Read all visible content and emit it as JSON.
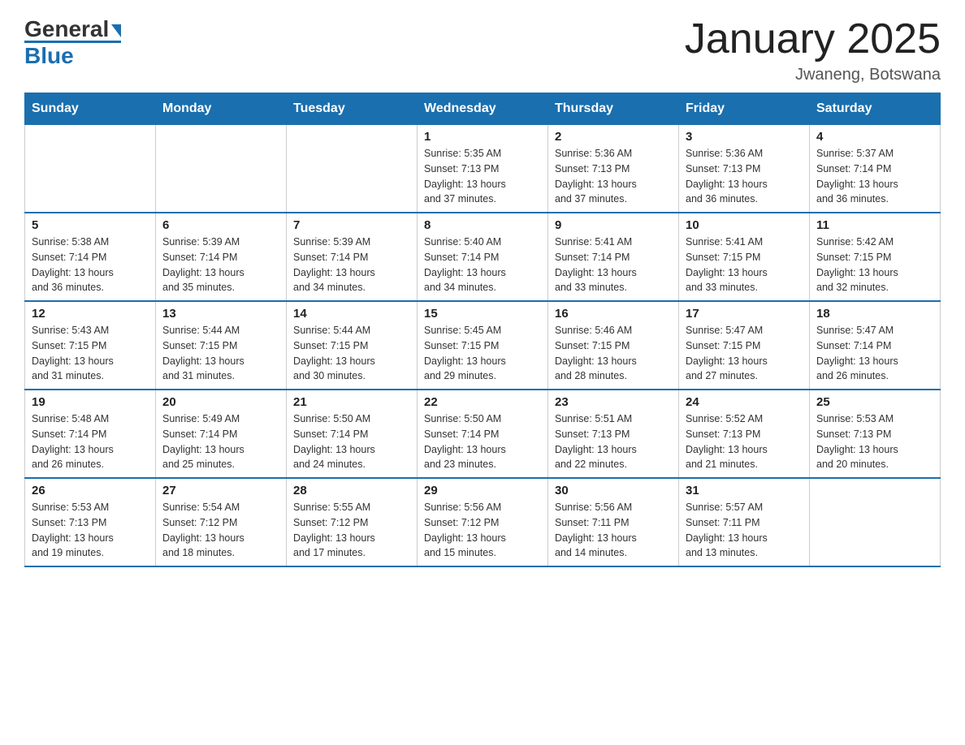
{
  "header": {
    "logo_general": "General",
    "logo_blue": "Blue",
    "title": "January 2025",
    "subtitle": "Jwaneng, Botswana"
  },
  "days_of_week": [
    "Sunday",
    "Monday",
    "Tuesday",
    "Wednesday",
    "Thursday",
    "Friday",
    "Saturday"
  ],
  "weeks": [
    [
      {
        "day": "",
        "info": ""
      },
      {
        "day": "",
        "info": ""
      },
      {
        "day": "",
        "info": ""
      },
      {
        "day": "1",
        "info": "Sunrise: 5:35 AM\nSunset: 7:13 PM\nDaylight: 13 hours\nand 37 minutes."
      },
      {
        "day": "2",
        "info": "Sunrise: 5:36 AM\nSunset: 7:13 PM\nDaylight: 13 hours\nand 37 minutes."
      },
      {
        "day": "3",
        "info": "Sunrise: 5:36 AM\nSunset: 7:13 PM\nDaylight: 13 hours\nand 36 minutes."
      },
      {
        "day": "4",
        "info": "Sunrise: 5:37 AM\nSunset: 7:14 PM\nDaylight: 13 hours\nand 36 minutes."
      }
    ],
    [
      {
        "day": "5",
        "info": "Sunrise: 5:38 AM\nSunset: 7:14 PM\nDaylight: 13 hours\nand 36 minutes."
      },
      {
        "day": "6",
        "info": "Sunrise: 5:39 AM\nSunset: 7:14 PM\nDaylight: 13 hours\nand 35 minutes."
      },
      {
        "day": "7",
        "info": "Sunrise: 5:39 AM\nSunset: 7:14 PM\nDaylight: 13 hours\nand 34 minutes."
      },
      {
        "day": "8",
        "info": "Sunrise: 5:40 AM\nSunset: 7:14 PM\nDaylight: 13 hours\nand 34 minutes."
      },
      {
        "day": "9",
        "info": "Sunrise: 5:41 AM\nSunset: 7:14 PM\nDaylight: 13 hours\nand 33 minutes."
      },
      {
        "day": "10",
        "info": "Sunrise: 5:41 AM\nSunset: 7:15 PM\nDaylight: 13 hours\nand 33 minutes."
      },
      {
        "day": "11",
        "info": "Sunrise: 5:42 AM\nSunset: 7:15 PM\nDaylight: 13 hours\nand 32 minutes."
      }
    ],
    [
      {
        "day": "12",
        "info": "Sunrise: 5:43 AM\nSunset: 7:15 PM\nDaylight: 13 hours\nand 31 minutes."
      },
      {
        "day": "13",
        "info": "Sunrise: 5:44 AM\nSunset: 7:15 PM\nDaylight: 13 hours\nand 31 minutes."
      },
      {
        "day": "14",
        "info": "Sunrise: 5:44 AM\nSunset: 7:15 PM\nDaylight: 13 hours\nand 30 minutes."
      },
      {
        "day": "15",
        "info": "Sunrise: 5:45 AM\nSunset: 7:15 PM\nDaylight: 13 hours\nand 29 minutes."
      },
      {
        "day": "16",
        "info": "Sunrise: 5:46 AM\nSunset: 7:15 PM\nDaylight: 13 hours\nand 28 minutes."
      },
      {
        "day": "17",
        "info": "Sunrise: 5:47 AM\nSunset: 7:15 PM\nDaylight: 13 hours\nand 27 minutes."
      },
      {
        "day": "18",
        "info": "Sunrise: 5:47 AM\nSunset: 7:14 PM\nDaylight: 13 hours\nand 26 minutes."
      }
    ],
    [
      {
        "day": "19",
        "info": "Sunrise: 5:48 AM\nSunset: 7:14 PM\nDaylight: 13 hours\nand 26 minutes."
      },
      {
        "day": "20",
        "info": "Sunrise: 5:49 AM\nSunset: 7:14 PM\nDaylight: 13 hours\nand 25 minutes."
      },
      {
        "day": "21",
        "info": "Sunrise: 5:50 AM\nSunset: 7:14 PM\nDaylight: 13 hours\nand 24 minutes."
      },
      {
        "day": "22",
        "info": "Sunrise: 5:50 AM\nSunset: 7:14 PM\nDaylight: 13 hours\nand 23 minutes."
      },
      {
        "day": "23",
        "info": "Sunrise: 5:51 AM\nSunset: 7:13 PM\nDaylight: 13 hours\nand 22 minutes."
      },
      {
        "day": "24",
        "info": "Sunrise: 5:52 AM\nSunset: 7:13 PM\nDaylight: 13 hours\nand 21 minutes."
      },
      {
        "day": "25",
        "info": "Sunrise: 5:53 AM\nSunset: 7:13 PM\nDaylight: 13 hours\nand 20 minutes."
      }
    ],
    [
      {
        "day": "26",
        "info": "Sunrise: 5:53 AM\nSunset: 7:13 PM\nDaylight: 13 hours\nand 19 minutes."
      },
      {
        "day": "27",
        "info": "Sunrise: 5:54 AM\nSunset: 7:12 PM\nDaylight: 13 hours\nand 18 minutes."
      },
      {
        "day": "28",
        "info": "Sunrise: 5:55 AM\nSunset: 7:12 PM\nDaylight: 13 hours\nand 17 minutes."
      },
      {
        "day": "29",
        "info": "Sunrise: 5:56 AM\nSunset: 7:12 PM\nDaylight: 13 hours\nand 15 minutes."
      },
      {
        "day": "30",
        "info": "Sunrise: 5:56 AM\nSunset: 7:11 PM\nDaylight: 13 hours\nand 14 minutes."
      },
      {
        "day": "31",
        "info": "Sunrise: 5:57 AM\nSunset: 7:11 PM\nDaylight: 13 hours\nand 13 minutes."
      },
      {
        "day": "",
        "info": ""
      }
    ]
  ]
}
